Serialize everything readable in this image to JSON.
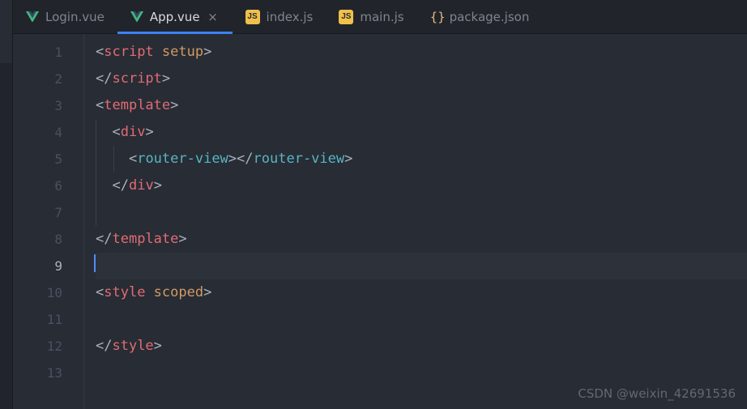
{
  "tabs": [
    {
      "label": "Login.vue",
      "icon": "vue",
      "active": false,
      "closeable": false
    },
    {
      "label": "App.vue",
      "icon": "vue",
      "active": true,
      "closeable": true
    },
    {
      "label": "index.js",
      "icon": "js",
      "active": false,
      "closeable": false
    },
    {
      "label": "main.js",
      "icon": "js",
      "active": false,
      "closeable": false
    },
    {
      "label": "package.json",
      "icon": "json",
      "active": false,
      "closeable": false
    }
  ],
  "icon_labels": {
    "js": "JS",
    "json": "{}"
  },
  "close_glyph": "×",
  "gutter": [
    "1",
    "2",
    "3",
    "4",
    "5",
    "6",
    "7",
    "8",
    "9",
    "10",
    "11",
    "12",
    "13"
  ],
  "code": {
    "l1": {
      "open": "<",
      "tag": "script",
      "attr": " setup",
      "close": ">"
    },
    "l2": {
      "open": "</",
      "tag": "script",
      "close": ">"
    },
    "l3": {
      "open": "<",
      "tag": "template",
      "close": ">"
    },
    "l4": {
      "open": "<",
      "tag": "div",
      "close": ">"
    },
    "l5": {
      "open": "<",
      "tag": "router-view",
      "close": ">",
      "open2": "</",
      "tag2": "router-view",
      "close2": ">"
    },
    "l6": {
      "open": "</",
      "tag": "div",
      "close": ">"
    },
    "l8": {
      "open": "</",
      "tag": "template",
      "close": ">"
    },
    "l10": {
      "open": "<",
      "tag": "style",
      "attr": " scoped",
      "close": ">"
    },
    "l12": {
      "open": "</",
      "tag": "style",
      "close": ">"
    }
  },
  "watermark": "CSDN @weixin_42691536"
}
